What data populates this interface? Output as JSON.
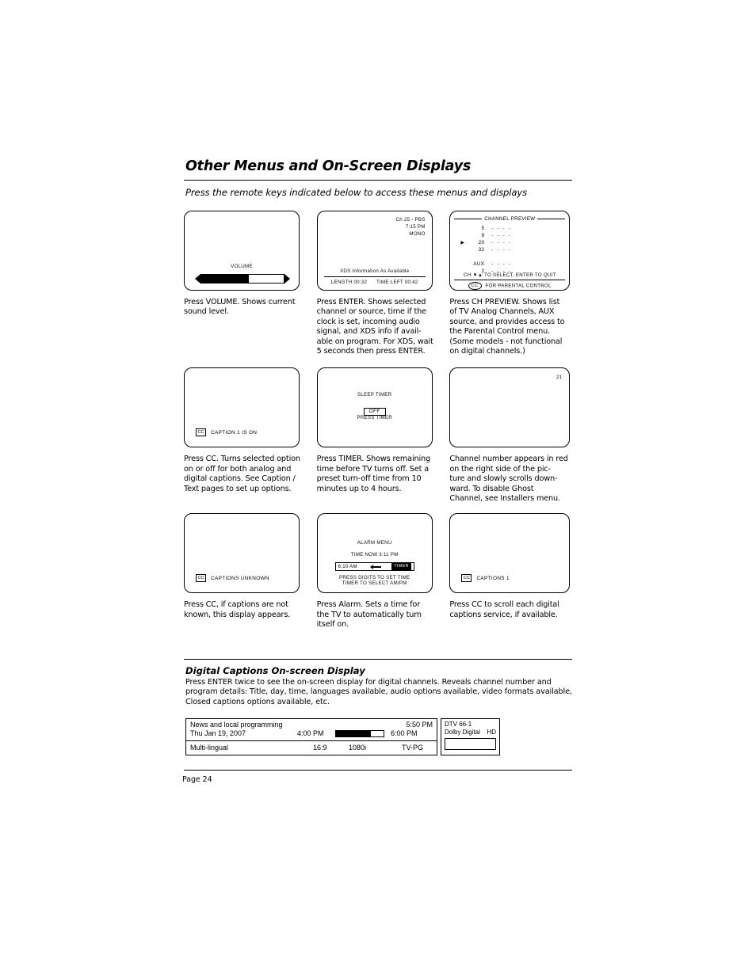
{
  "header": {
    "title": "Other Menus and On-Screen Displays",
    "subtitle": "Press the remote keys indicated below to access these menus and displays"
  },
  "screens": {
    "volume": {
      "label": "VOLUME",
      "fill_percent": 58
    },
    "enter_xds": {
      "channel": "Ch 25 - PBS",
      "time": "7:15 PM",
      "audio": "MONO",
      "xds_line": "XDS Information As Available",
      "length": "LENGTH 00:32",
      "time_left": "TIME LEFT 00:42"
    },
    "channel_preview": {
      "title": "CHANNEL PREVIEW",
      "items": [
        {
          "arrow": "",
          "number": "5",
          "dashes": "- - - -"
        },
        {
          "arrow": "",
          "number": "9",
          "dashes": "- - - -"
        },
        {
          "arrow": "▶",
          "number": "20",
          "dashes": "- - - -"
        },
        {
          "arrow": "",
          "number": "32",
          "dashes": "- - - -"
        },
        {
          "arrow": "",
          "number": "",
          "dashes": ""
        },
        {
          "arrow": "",
          "number": "AUX",
          "dashes": "- - - -"
        },
        {
          "arrow": "",
          "number": "2",
          "dashes": "- - - -"
        }
      ],
      "hint": "CH ▼▲  TO SELECT, ENTER TO QUIT",
      "footer_icon": "CC",
      "footer": "FOR PARENTAL CONTROL"
    },
    "caption_on": {
      "icon": "CC",
      "text": "CAPTION 1 IS ON"
    },
    "sleep_timer": {
      "title": "SLEEP TIMER",
      "value": "OFF",
      "press": "PRESS TIMER"
    },
    "ghost_channel": {
      "number": "21"
    },
    "captions_unknown": {
      "icon": "CC",
      "text": "CAPTIONS UNKNOWN"
    },
    "alarm_menu": {
      "title": "ALARM MENU",
      "time_now": "TIME NOW   3:11 PM",
      "alarm_time": "6:10  AM",
      "timer_badge": "TIMER",
      "footer_line1": "PRESS DIGITS TO SET TIME",
      "footer_line2": "TIMER TO SELECT AM/PM"
    },
    "captions_1": {
      "icon": "CC",
      "text": "CAPTIONS 1"
    }
  },
  "captions": {
    "volume": "Press VOLUME. Shows current\nsound level.",
    "enter": "Press ENTER. Shows selected\nchannel or source, time if the\nclock is set, incoming audio\nsignal, and XDS info if avail-\nable on program. For XDS, wait\n5 seconds then press ENTER.",
    "ch_preview": "Press CH PREVIEW. Shows list\nof TV Analog Channels, AUX\nsource, and provides access to\nthe Parental Control menu.\n(Some models - not functional\non digital channels.)",
    "cc": "Press CC. Turns selected option\non or off for both analog and\ndigital captions. See Caption /\nText pages to set up options.",
    "timer": "Press TIMER. Shows remaining\ntime before TV turns off. Set a\npreset turn-off time from 10\nminutes up to 4 hours.",
    "ghost": "Channel number appears in red\non the right side of the pic-\nture and slowly scrolls down-\nward. To disable Ghost\nChannel, see Installers menu.",
    "cc_unknown": "Press CC, if captions are not\nknown, this display appears.",
    "alarm": "Press Alarm. Sets a time for\nthe TV to automatically turn\nitself on.",
    "cc_digital": "Press CC to scroll each digital\ncaptions service, if available."
  },
  "digital_section": {
    "heading": "Digital Captions On-screen Display",
    "body": "Press ENTER twice to see the on-screen display for digital channels. Reveals channel number and program details: Title, day, time, languages available, audio options available, video formats available, Closed captions options available, etc."
  },
  "dtv_osd": {
    "program_title": "News and local programming",
    "current_time": "5:50 PM",
    "date": "Thu Jan 19, 2007",
    "start_time": "4:00 PM",
    "end_time": "6:00 PM",
    "progress_percent": 74,
    "language": "Multi-lingual",
    "aspect_ratio": "16:9",
    "resolution": "1080i",
    "rating": "TV-PG",
    "channel": "DTV 66-1",
    "audio_format": "Dolby Digital",
    "hd_badge": "HD"
  },
  "footer": {
    "page_label": "Page  24"
  }
}
